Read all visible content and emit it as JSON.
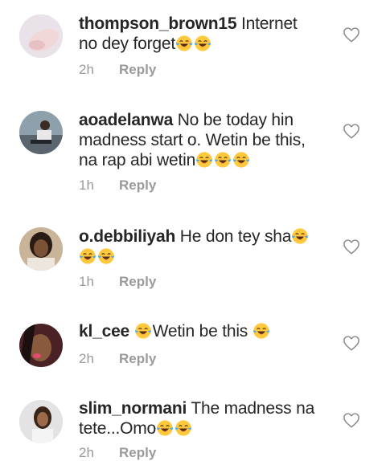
{
  "comments": [
    {
      "username": "thompson_brown15",
      "text_parts": [
        "Internet no dey forget"
      ],
      "emoji_count": 2,
      "time": "2h",
      "reply": "Reply"
    },
    {
      "username": "aoadelanwa",
      "text_parts": [
        "No be today hin madness start o. Wetin be this, na rap abi wetin"
      ],
      "emoji_count": 3,
      "time": "1h",
      "reply": "Reply"
    },
    {
      "username": "o.debbiliyah",
      "text_parts": [
        "He don tey sha"
      ],
      "emoji_count": 3,
      "time": "1h",
      "reply": "Reply"
    },
    {
      "username": "kl_cee",
      "text_parts": [
        "Wetin be this"
      ],
      "emoji_count": 2,
      "time": "2h",
      "reply": "Reply"
    },
    {
      "username": "slim_normani",
      "text_parts": [
        "The madness na tete...Omo"
      ],
      "emoji_count": 2,
      "time": "2h",
      "reply": "Reply"
    }
  ],
  "icons": {
    "like": "heart-outline-icon",
    "emoji": "face-with-tears-of-joy-emoji"
  },
  "colors": {
    "text": "#262626",
    "meta": "#9a9a9a",
    "emoji_face": "#FFC83D",
    "emoji_tears": "#3FA8F4"
  }
}
